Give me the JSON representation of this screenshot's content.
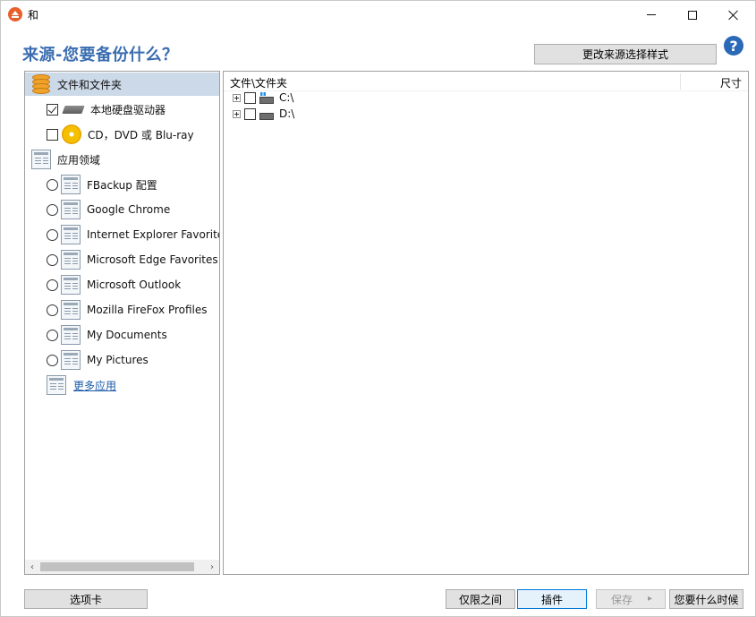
{
  "window": {
    "title": "和",
    "controls": {
      "minimize": "minimize",
      "maximize": "maximize",
      "close": "close"
    }
  },
  "header": {
    "heading": "来源-您要备份什么？",
    "change_style_button": "更改来源选择样式",
    "help_glyph": "?"
  },
  "left_panel": {
    "items": [
      {
        "label": "文件和文件夹",
        "icon": "database-icon",
        "control": "none",
        "selected": true
      },
      {
        "label": "本地硬盘驱动器",
        "icon": "hard-drive-icon",
        "control": "checkbox",
        "checked": true
      },
      {
        "label": "CD，DVD 或 Blu-ray",
        "icon": "cd-icon",
        "control": "checkbox",
        "checked": false
      },
      {
        "label": "应用领域",
        "icon": "app-page-icon",
        "control": "none"
      },
      {
        "label": "FBackup 配置",
        "icon": "app-page-icon",
        "control": "radio"
      },
      {
        "label": "Google Chrome",
        "icon": "app-page-icon",
        "control": "radio"
      },
      {
        "label": "Internet Explorer Favorites",
        "icon": "app-page-icon",
        "control": "radio"
      },
      {
        "label": "Microsoft Edge Favorites",
        "icon": "app-page-icon",
        "control": "radio"
      },
      {
        "label": "Microsoft Outlook",
        "icon": "app-page-icon",
        "control": "radio"
      },
      {
        "label": "Mozilla FireFox Profiles",
        "icon": "app-page-icon",
        "control": "radio"
      },
      {
        "label": "My Documents",
        "icon": "app-page-icon",
        "control": "radio"
      },
      {
        "label": "My Pictures",
        "icon": "app-page-icon",
        "control": "radio"
      },
      {
        "label": "更多应用",
        "icon": "app-page-icon",
        "control": "link"
      }
    ],
    "scroll_left": "‹",
    "scroll_right": "›"
  },
  "right_panel": {
    "columns": {
      "name": "文件\\文件夹",
      "size": "尺寸"
    },
    "drives": [
      {
        "label": "C:\\",
        "icon": "system-drive-icon"
      },
      {
        "label": "D:\\",
        "icon": "drive-icon"
      }
    ]
  },
  "footer": {
    "tabs_button": "选项卡",
    "only_between_button": "仅限之间",
    "plugin_button": "插件",
    "save_button": "保存",
    "save_arrow": "▸",
    "when_button": "您要什么时候"
  },
  "colors": {
    "heading": "#3a6db0",
    "selected_row": "#ccd9e8",
    "help": "#2a69b8",
    "app_icon": "#e8602c"
  }
}
